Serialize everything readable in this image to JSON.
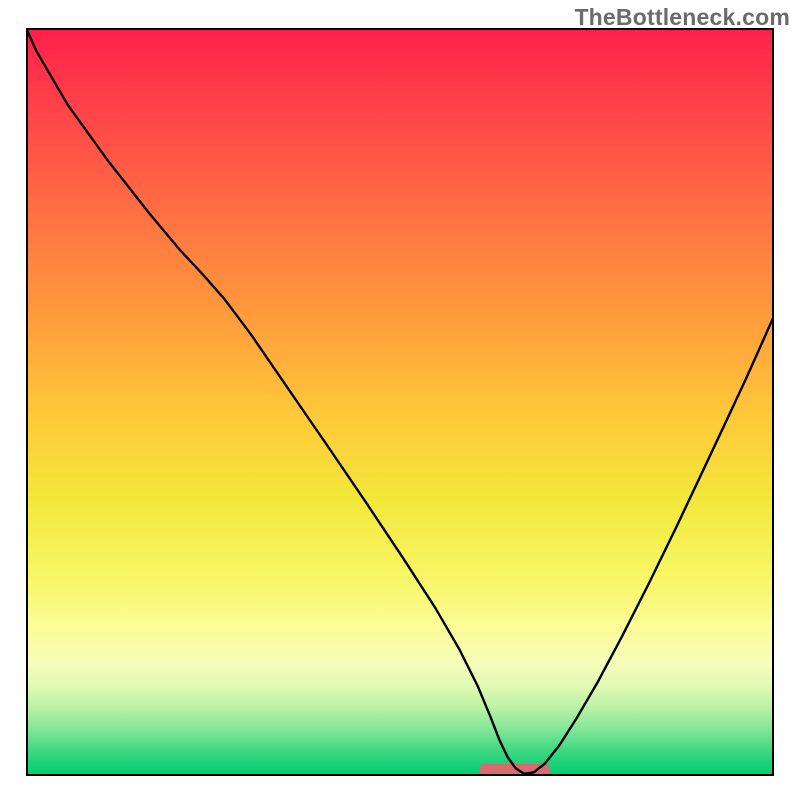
{
  "watermark": "TheBottleneck.com",
  "marker": {
    "x_pct": 60.5,
    "width_pct": 9.5,
    "y_pct": 98.4
  },
  "curve_points": [
    [
      0.0,
      0.0
    ],
    [
      0.014,
      0.031
    ],
    [
      0.056,
      0.103
    ],
    [
      0.11,
      0.178
    ],
    [
      0.165,
      0.248
    ],
    [
      0.206,
      0.297
    ],
    [
      0.235,
      0.328
    ],
    [
      0.265,
      0.362
    ],
    [
      0.301,
      0.41
    ],
    [
      0.349,
      0.48
    ],
    [
      0.404,
      0.56
    ],
    [
      0.455,
      0.635
    ],
    [
      0.503,
      0.707
    ],
    [
      0.547,
      0.775
    ],
    [
      0.579,
      0.83
    ],
    [
      0.604,
      0.88
    ],
    [
      0.621,
      0.921
    ],
    [
      0.633,
      0.952
    ],
    [
      0.644,
      0.975
    ],
    [
      0.655,
      0.99
    ],
    [
      0.666,
      0.997
    ],
    [
      0.679,
      0.995
    ],
    [
      0.694,
      0.983
    ],
    [
      0.713,
      0.959
    ],
    [
      0.736,
      0.923
    ],
    [
      0.764,
      0.875
    ],
    [
      0.796,
      0.815
    ],
    [
      0.833,
      0.742
    ],
    [
      0.87,
      0.666
    ],
    [
      0.904,
      0.594
    ],
    [
      0.935,
      0.528
    ],
    [
      0.963,
      0.468
    ],
    [
      0.984,
      0.421
    ],
    [
      1.0,
      0.385
    ]
  ],
  "chart_data": {
    "type": "line",
    "title": "",
    "xlabel": "",
    "ylabel": "",
    "xlim": [
      0,
      1
    ],
    "ylim": [
      0,
      1
    ],
    "series": [
      {
        "name": "bottleneck_curve",
        "x": [
          0.0,
          0.014,
          0.056,
          0.11,
          0.165,
          0.206,
          0.235,
          0.265,
          0.301,
          0.349,
          0.404,
          0.455,
          0.503,
          0.547,
          0.579,
          0.604,
          0.621,
          0.633,
          0.644,
          0.655,
          0.666,
          0.679,
          0.694,
          0.713,
          0.736,
          0.764,
          0.796,
          0.833,
          0.87,
          0.904,
          0.935,
          0.963,
          0.984,
          1.0
        ],
        "y": [
          100,
          96.9,
          89.7,
          82.2,
          75.2,
          70.3,
          67.2,
          63.8,
          59.0,
          52.0,
          44.0,
          36.5,
          29.3,
          22.5,
          17.0,
          12.0,
          7.9,
          4.8,
          2.5,
          1.0,
          0.3,
          0.5,
          1.7,
          4.1,
          7.7,
          12.5,
          18.5,
          25.8,
          33.4,
          40.6,
          47.2,
          53.2,
          57.9,
          61.5
        ]
      }
    ],
    "optimal_range_x": [
      0.605,
      0.7
    ],
    "background": "red-yellow-green vertical heat gradient"
  }
}
